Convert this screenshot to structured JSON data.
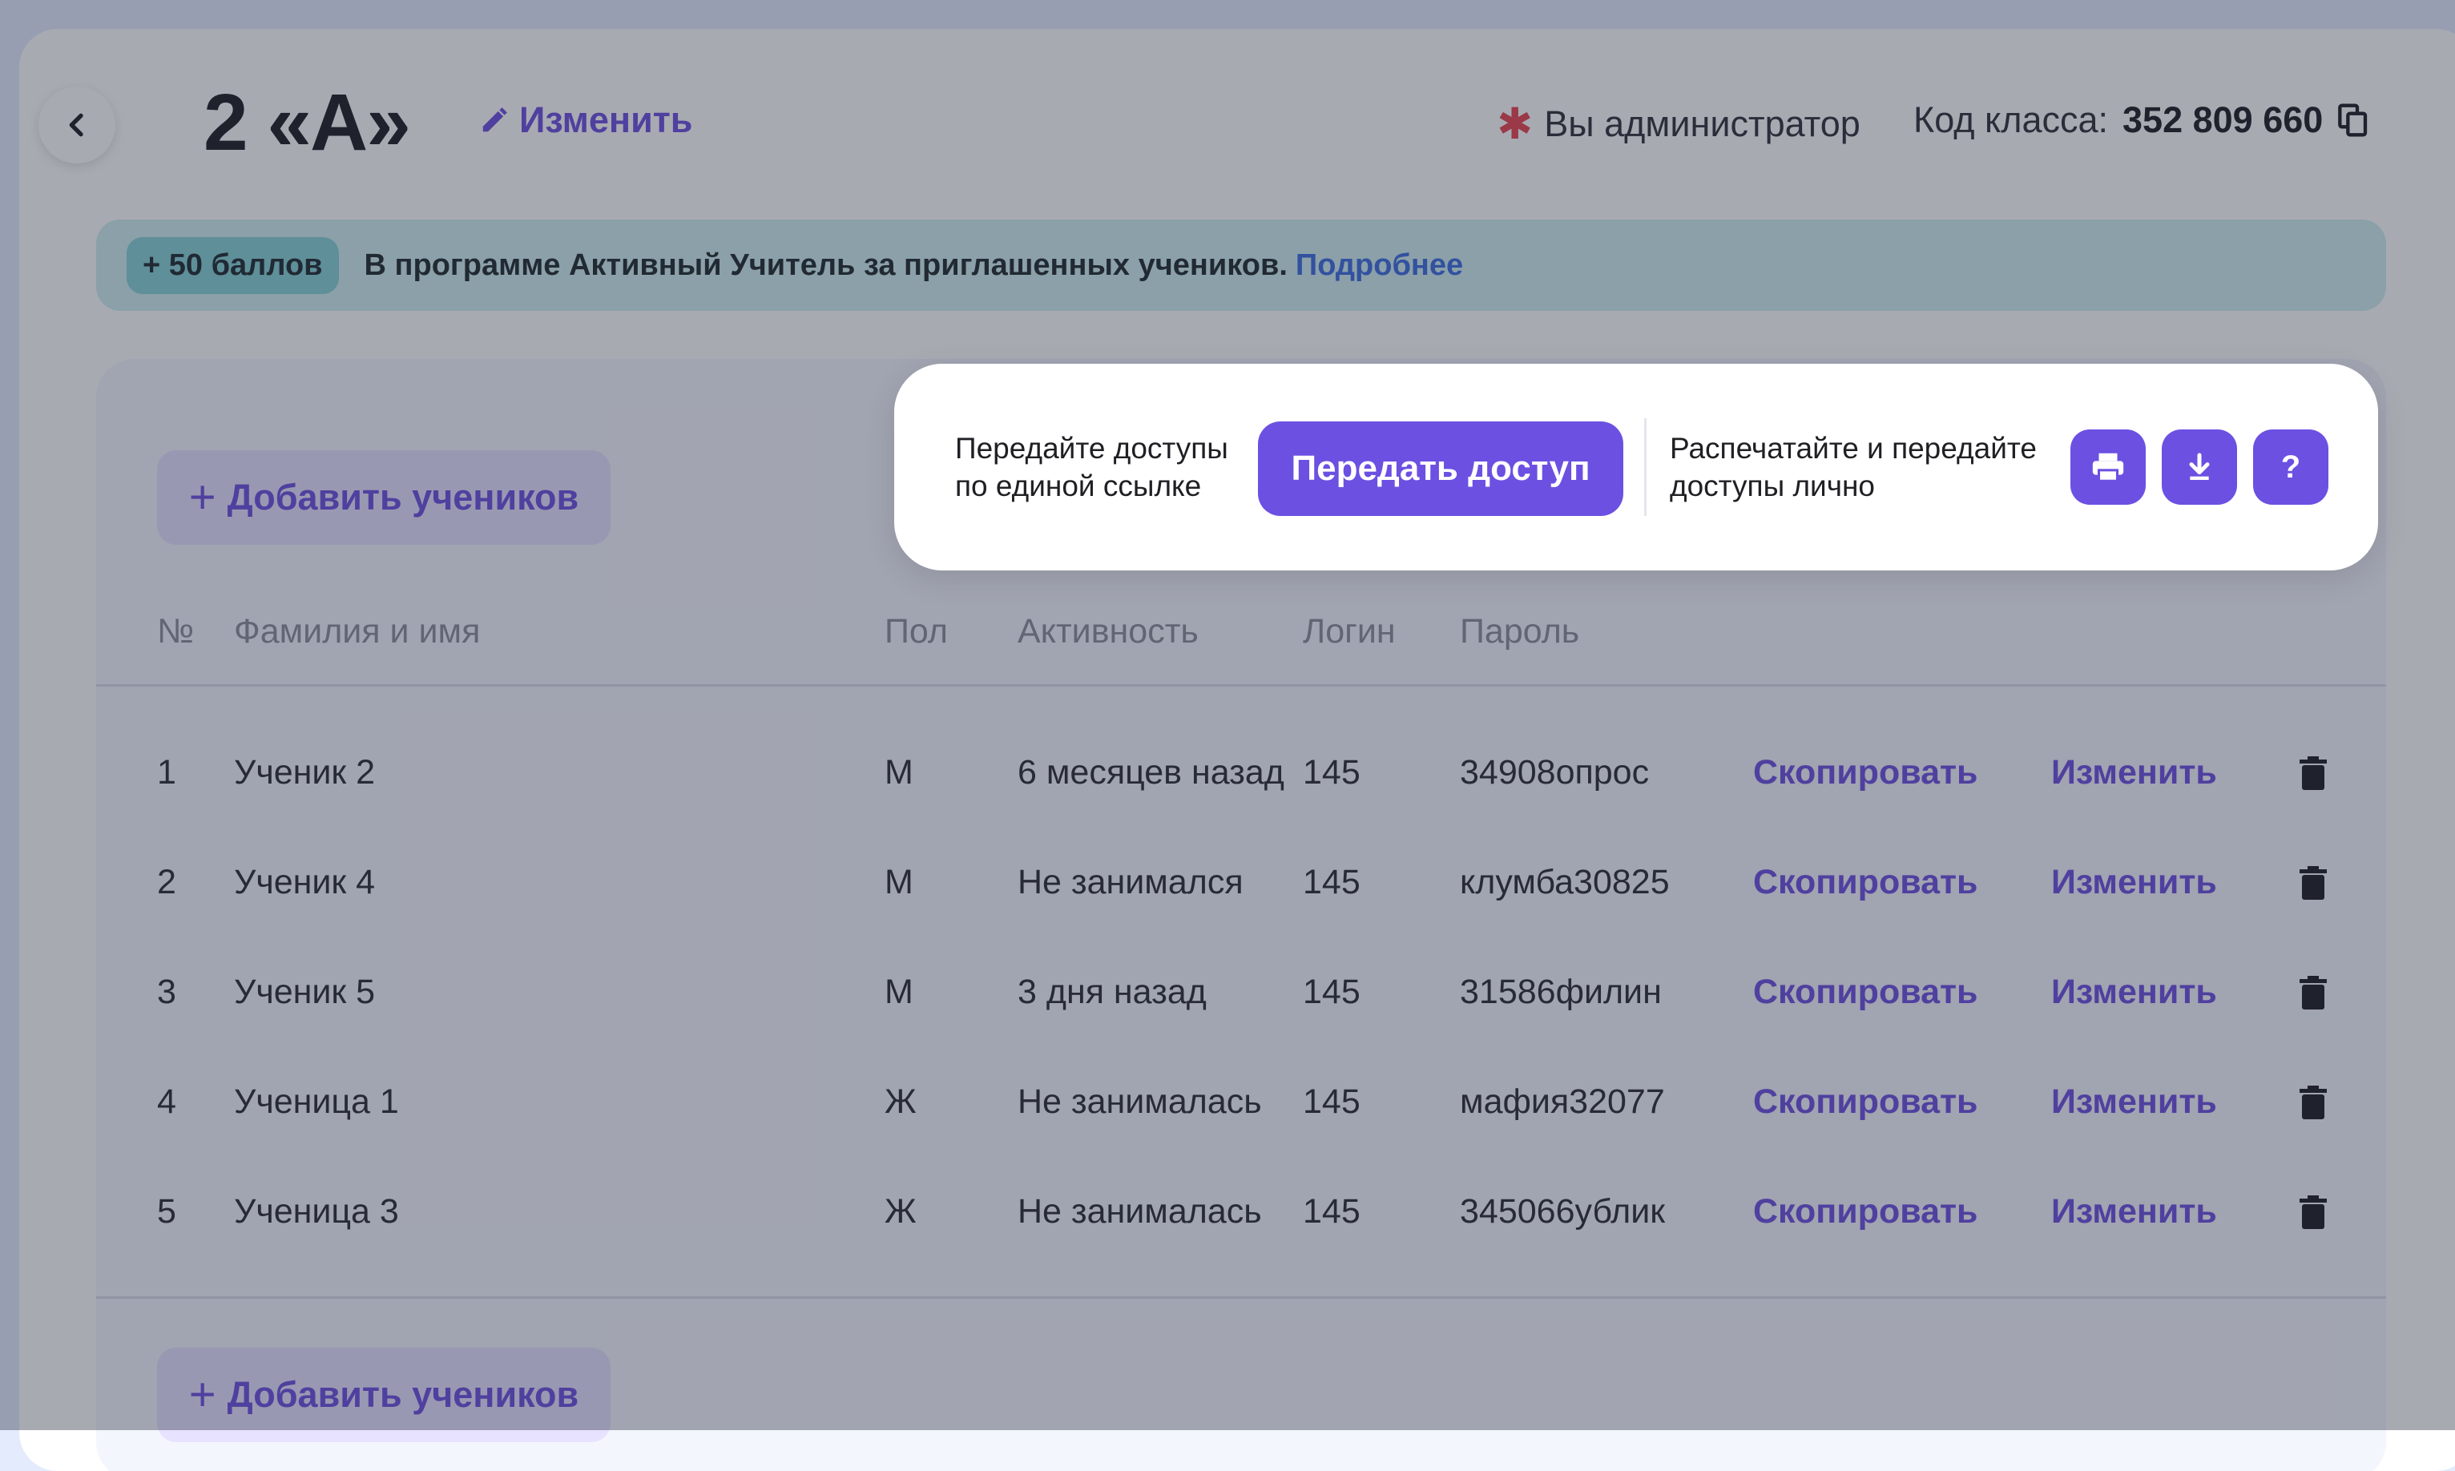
{
  "header": {
    "title": "2 «А»",
    "edit_label": "Изменить",
    "admin_label": "Вы администратор",
    "code_label": "Код класса:",
    "code_value": "352 809 660"
  },
  "banner": {
    "badge": "+ 50 баллов",
    "text": "В программе Активный Учитель за приглашенных учеников.",
    "link": "Подробнее"
  },
  "add_button_label": "Добавить учеников",
  "columns": [
    "№",
    "Фамилия и имя",
    "Пол",
    "Активность",
    "Логин",
    "Пароль"
  ],
  "students": [
    {
      "num": "1",
      "name": "Ученик 2",
      "sex": "М",
      "activity": "6 месяцев назад",
      "login": "145",
      "password": "34908опрос"
    },
    {
      "num": "2",
      "name": "Ученик 4",
      "sex": "М",
      "activity": "Не занимался",
      "login": "145",
      "password": "клумба30825"
    },
    {
      "num": "3",
      "name": "Ученик 5",
      "sex": "М",
      "activity": "3 дня назад",
      "login": "145",
      "password": "31586филин"
    },
    {
      "num": "4",
      "name": "Ученица 1",
      "sex": "Ж",
      "activity": "Не занималась",
      "login": "145",
      "password": "мафия32077"
    },
    {
      "num": "5",
      "name": "Ученица 3",
      "sex": "Ж",
      "activity": "Не занималась",
      "login": "145",
      "password": "345066ублик"
    }
  ],
  "row_actions": {
    "copy": "Скопировать",
    "edit": "Изменить"
  },
  "popup": {
    "share_text_1": "Передайте доступы",
    "share_text_2": "по единой ссылке",
    "share_button": "Передать доступ",
    "print_text_1": "Распечатайте и передайте",
    "print_text_2": "доступы лично",
    "help_label": "?"
  },
  "colors": {
    "accent": "#6c50e2",
    "banner": "#cfeff0",
    "star": "#e8444d",
    "link": "#3b6be0"
  },
  "icons": [
    "chevron-left-icon",
    "pencil-icon",
    "star-icon",
    "copy-icon",
    "plus-icon",
    "trash-icon",
    "printer-icon",
    "download-icon"
  ]
}
